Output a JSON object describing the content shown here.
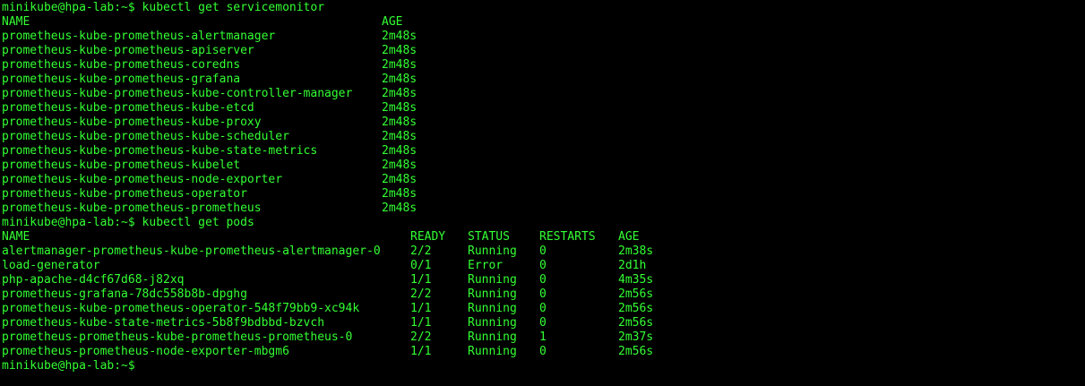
{
  "terminal": {
    "prompt": "minikube@hpa-lab:~$",
    "colors": {
      "background": "#000000",
      "foreground": "#33ff33"
    },
    "cmd1": "kubectl get servicemonitor",
    "sm_headers": {
      "name": "NAME",
      "age": "AGE"
    },
    "servicemonitors": [
      {
        "name": "prometheus-kube-prometheus-alertmanager",
        "age": "2m48s"
      },
      {
        "name": "prometheus-kube-prometheus-apiserver",
        "age": "2m48s"
      },
      {
        "name": "prometheus-kube-prometheus-coredns",
        "age": "2m48s"
      },
      {
        "name": "prometheus-kube-prometheus-grafana",
        "age": "2m48s"
      },
      {
        "name": "prometheus-kube-prometheus-kube-controller-manager",
        "age": "2m48s"
      },
      {
        "name": "prometheus-kube-prometheus-kube-etcd",
        "age": "2m48s"
      },
      {
        "name": "prometheus-kube-prometheus-kube-proxy",
        "age": "2m48s"
      },
      {
        "name": "prometheus-kube-prometheus-kube-scheduler",
        "age": "2m48s"
      },
      {
        "name": "prometheus-kube-prometheus-kube-state-metrics",
        "age": "2m48s"
      },
      {
        "name": "prometheus-kube-prometheus-kubelet",
        "age": "2m48s"
      },
      {
        "name": "prometheus-kube-prometheus-node-exporter",
        "age": "2m48s"
      },
      {
        "name": "prometheus-kube-prometheus-operator",
        "age": "2m48s"
      },
      {
        "name": "prometheus-kube-prometheus-prometheus",
        "age": "2m48s"
      }
    ],
    "cmd2": "kubectl get pods",
    "pod_headers": {
      "name": "NAME",
      "ready": "READY",
      "status": "STATUS",
      "restarts": "RESTARTS",
      "age": "AGE"
    },
    "pods": [
      {
        "name": "alertmanager-prometheus-kube-prometheus-alertmanager-0",
        "ready": "2/2",
        "status": "Running",
        "restarts": "0",
        "age": "2m38s"
      },
      {
        "name": "load-generator",
        "ready": "0/1",
        "status": "Error",
        "restarts": "0",
        "age": "2d1h"
      },
      {
        "name": "php-apache-d4cf67d68-j82xq",
        "ready": "1/1",
        "status": "Running",
        "restarts": "0",
        "age": "4m35s"
      },
      {
        "name": "prometheus-grafana-78dc558b8b-dpghg",
        "ready": "2/2",
        "status": "Running",
        "restarts": "0",
        "age": "2m56s"
      },
      {
        "name": "prometheus-kube-prometheus-operator-548f79bb9-xc94k",
        "ready": "1/1",
        "status": "Running",
        "restarts": "0",
        "age": "2m56s"
      },
      {
        "name": "prometheus-kube-state-metrics-5b8f9bdbbd-bzvch",
        "ready": "1/1",
        "status": "Running",
        "restarts": "0",
        "age": "2m56s"
      },
      {
        "name": "prometheus-prometheus-kube-prometheus-prometheus-0",
        "ready": "2/2",
        "status": "Running",
        "restarts": "1",
        "age": "2m37s"
      },
      {
        "name": "prometheus-prometheus-node-exporter-mbgm6",
        "ready": "1/1",
        "status": "Running",
        "restarts": "0",
        "age": "2m56s"
      }
    ]
  }
}
